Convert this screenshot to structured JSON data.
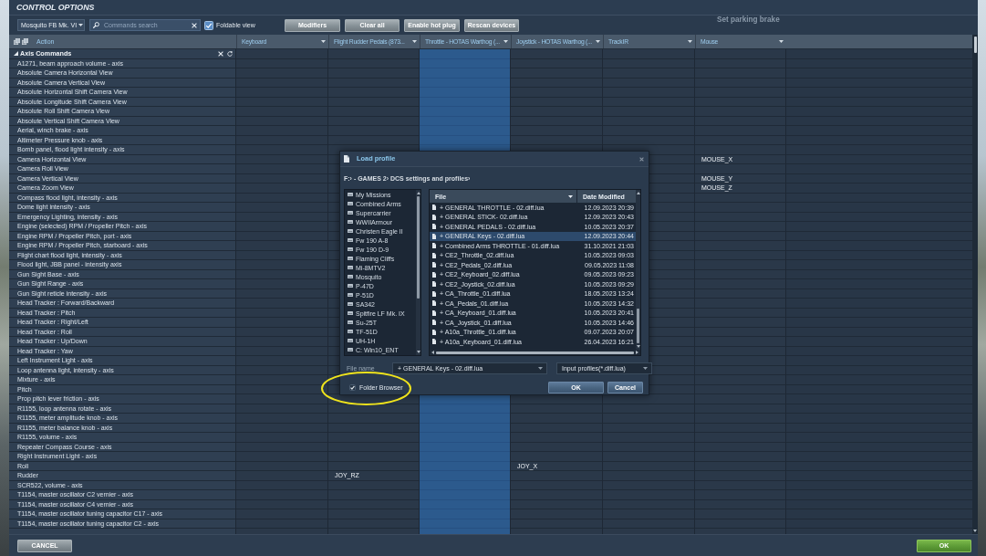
{
  "window": {
    "title": "CONTROL OPTIONS"
  },
  "toolbar": {
    "aircraft": "Mosquito FB Mk. VI",
    "search": {
      "placeholder": "Commands search"
    },
    "foldable_view": {
      "label": "Foldable view",
      "checked": true
    },
    "buttons": [
      "Modifiers",
      "Clear all",
      "Enable hot plug",
      "Rescan devices"
    ],
    "hint": "Set parking brake"
  },
  "table": {
    "action_header": "Action",
    "columns": [
      {
        "label": "Keyboard",
        "selected": false
      },
      {
        "label": "Flight Rudder Pedals (873...",
        "selected": false
      },
      {
        "label": "Throttle - HOTAS Warthog (...",
        "selected": true
      },
      {
        "label": "Joystick - HOTAS Warthog (...",
        "selected": false
      },
      {
        "label": "TrackIR",
        "selected": false
      },
      {
        "label": "Mouse",
        "selected": false
      }
    ],
    "group": {
      "label": "Axis Commands",
      "expanded": true
    },
    "rows": [
      {
        "action": "A1271, beam approach volume - axis"
      },
      {
        "action": "Absolute Camera Horizontal View"
      },
      {
        "action": "Absolute Camera Vertical View"
      },
      {
        "action": "Absolute Horizontal Shift Camera View"
      },
      {
        "action": "Absolute Longitude Shift Camera View"
      },
      {
        "action": "Absolute Roll Shift Camera View"
      },
      {
        "action": "Absolute Vertical Shift Camera View"
      },
      {
        "action": "Aerial, winch brake - axis"
      },
      {
        "action": "Altimeter Pressure knob - axis"
      },
      {
        "action": "Bomb panel, flood light intensity - axis"
      },
      {
        "action": "Camera Horizontal View",
        "cells": [
          null,
          null,
          null,
          null,
          null,
          "MOUSE_X"
        ]
      },
      {
        "action": "Camera Roll View"
      },
      {
        "action": "Camera Vertical View",
        "cells": [
          null,
          null,
          null,
          null,
          null,
          "MOUSE_Y"
        ]
      },
      {
        "action": "Camera Zoom View",
        "cells": [
          null,
          null,
          null,
          null,
          null,
          "MOUSE_Z"
        ]
      },
      {
        "action": "Compass flood light, intensity - axis"
      },
      {
        "action": "Dome light intensity - axis"
      },
      {
        "action": "Emergency Lighting, intensity - axis"
      },
      {
        "action": "Engine (selected) RPM / Propeller Pitch - axis"
      },
      {
        "action": "Engine RPM / Propeller Pitch, port - axis"
      },
      {
        "action": "Engine RPM / Propeller Pitch, starboard - axis"
      },
      {
        "action": "Flight chart flood light, intensity - axis"
      },
      {
        "action": "Flood light, JBB panel - intensity axis"
      },
      {
        "action": "Gun Sight Base - axis"
      },
      {
        "action": "Gun Sight Range - axis"
      },
      {
        "action": "Gun Sight reticle intensity - axis"
      },
      {
        "action": "Head Tracker : Forward/Backward"
      },
      {
        "action": "Head Tracker : Pitch"
      },
      {
        "action": "Head Tracker : Right/Left"
      },
      {
        "action": "Head Tracker : Roll"
      },
      {
        "action": "Head Tracker : Up/Down"
      },
      {
        "action": "Head Tracker : Yaw"
      },
      {
        "action": "Left Instrument Light - axis"
      },
      {
        "action": "Loop antenna light, intensity - axis"
      },
      {
        "action": "Mixture - axis"
      },
      {
        "action": "Pitch"
      },
      {
        "action": "Prop pitch lever friction - axis"
      },
      {
        "action": "R1155, loop antenna rotate - axis"
      },
      {
        "action": "R1155, meter amplitude knob - axis"
      },
      {
        "action": "R1155, meter balance knob - axis"
      },
      {
        "action": "R1155, volume - axis"
      },
      {
        "action": "Repeater Compass Course - axis"
      },
      {
        "action": "Right Instrument Light - axis"
      },
      {
        "action": "Roll",
        "cells": [
          null,
          null,
          null,
          "JOY_X",
          null,
          null
        ]
      },
      {
        "action": "Rudder",
        "cells": [
          null,
          "JOY_RZ",
          null,
          null,
          null,
          null
        ]
      },
      {
        "action": "SCR522, volume - axis"
      },
      {
        "action": "T1154, master oscillator C2 vernier - axis"
      },
      {
        "action": "T1154, master oscillator C4 vernier - axis"
      },
      {
        "action": "T1154, master oscillator tuning capacitor C17 - axis"
      },
      {
        "action": "T1154, master oscillator tuning capacitor C2 - axis"
      }
    ]
  },
  "dialog": {
    "title": "Load profile",
    "path": "F:› - GAMES 2› DCS settings and profiles›",
    "folders": [
      "My Missions",
      "Combined Arms",
      "Supercarrier",
      "WWIIArmour",
      "Christen Eagle II",
      "Fw 190 A-8",
      "Fw 190 D-9",
      "Flaming Cliffs",
      "Mi-8MTV2",
      "Mosquito",
      "P-47D",
      "P-51D",
      "SA342",
      "Spitfire LF Mk. IX",
      "Su-25T",
      "TF-51D",
      "UH-1H",
      "C: Win10_ENT"
    ],
    "file_columns": [
      {
        "label": "File",
        "sorted": true
      },
      {
        "label": "Date Modified",
        "sorted": false
      }
    ],
    "files": [
      {
        "name": "+ GENERAL THROTTLE - 02.diff.lua",
        "date": "12.09.2023 20:39",
        "selected": false
      },
      {
        "name": "+ GENERAL STICK- 02.diff.lua",
        "date": "12.09.2023 20:43",
        "selected": false
      },
      {
        "name": "+ GENERAL PEDALS - 02.diff.lua",
        "date": "10.05.2023 20:37",
        "selected": false
      },
      {
        "name": "+ GENERAL Keys - 02.diff.lua",
        "date": "12.09.2023 20:44",
        "selected": true
      },
      {
        "name": "+ Combined Arms THROTTLE - 01.diff.lua",
        "date": "31.10.2021 21:03",
        "selected": false
      },
      {
        "name": "+ CE2_Throttle_02.diff.lua",
        "date": "10.05.2023 09:03",
        "selected": false
      },
      {
        "name": "+ CE2_Pedals_02.diff.lua",
        "date": "09.05.2023 11:08",
        "selected": false
      },
      {
        "name": "+ CE2_Keyboard_02.diff.lua",
        "date": "09.05.2023 09:23",
        "selected": false
      },
      {
        "name": "+ CE2_Joystick_02.diff.lua",
        "date": "10.05.2023 09:29",
        "selected": false
      },
      {
        "name": "+ CA_Throttle_01.diff.lua",
        "date": "18.05.2023 13:24",
        "selected": false
      },
      {
        "name": "+ CA_Pedals_01.diff.lua",
        "date": "10.05.2023 14:32",
        "selected": false
      },
      {
        "name": "+ CA_Keyboard_01.diff.lua",
        "date": "10.05.2023 20:41",
        "selected": false
      },
      {
        "name": "+ CA_Joystick_01.diff.lua",
        "date": "10.05.2023 14:46",
        "selected": false
      },
      {
        "name": "+ A10a_Throttle_01.diff.lua",
        "date": "09.07.2023 20:07",
        "selected": false
      },
      {
        "name": "+ A10a_Keyboard_01.diff.lua",
        "date": "26.04.2023 16:21",
        "selected": false
      }
    ],
    "file_name": {
      "label": "File name",
      "value": "+ GENERAL Keys - 02.diff.lua"
    },
    "file_type": "Input profiles(*.diff.lua)",
    "folder_browser": {
      "label": "Folder Browser",
      "checked": true
    },
    "buttons": [
      "OK",
      "Cancel"
    ]
  },
  "footer": {
    "buttons": [
      {
        "label": "CANCEL",
        "kind": "secondary"
      },
      {
        "label": "OK",
        "kind": "primary"
      }
    ]
  }
}
